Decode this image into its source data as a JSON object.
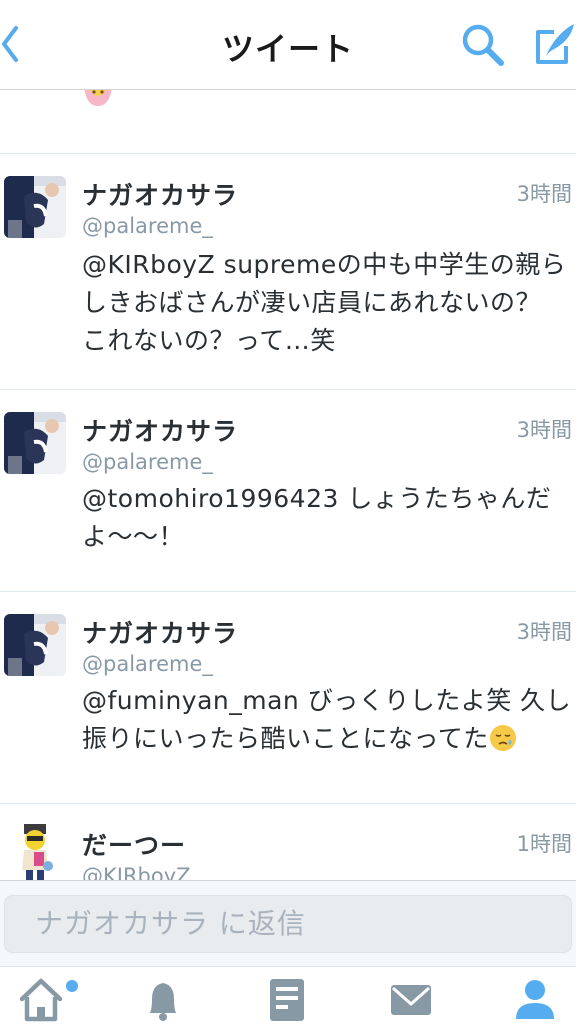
{
  "header": {
    "title": "ツイート",
    "back_icon": "chevron-left-icon",
    "search_icon": "search-icon",
    "compose_icon": "compose-tweet-icon",
    "accent_color": "#55acee"
  },
  "timeline": {
    "top_stub_icon": "emoji-icon",
    "tweets": [
      {
        "name": "ナガオカサラ",
        "handle": "@palareme_",
        "time": "3時間",
        "lines": [
          "@KIRboyZ supremeの中も中学生の親ら",
          "しきおばさんが凄い店員にあれないの？",
          "これないの？って…笑"
        ]
      },
      {
        "name": "ナガオカサラ",
        "handle": "@palareme_",
        "time": "3時間",
        "lines": [
          "@tomohiro1996423 しょうたちゃんだ",
          "よ〜〜！"
        ]
      },
      {
        "name": "ナガオカサラ",
        "handle": "@palareme_",
        "time": "3時間",
        "lines": [
          "@fuminyan_man びっくりしたよ笑 久し",
          "振りにいったら酷いことになってた"
        ],
        "trailing_emoji": "sleepy-face-emoji-icon"
      },
      {
        "name": "だーつー",
        "handle": "@KIRboyZ",
        "time": "1時間"
      }
    ]
  },
  "reply": {
    "placeholder": "ナガオカサラ に返信"
  },
  "tabbar": {
    "items": [
      {
        "icon": "home-icon",
        "has_badge": true
      },
      {
        "icon": "bell-icon"
      },
      {
        "icon": "discover-icon"
      },
      {
        "icon": "mail-icon"
      },
      {
        "icon": "profile-icon",
        "active": true
      }
    ],
    "inactive_color": "#8899a6",
    "active_color": "#55acee"
  }
}
